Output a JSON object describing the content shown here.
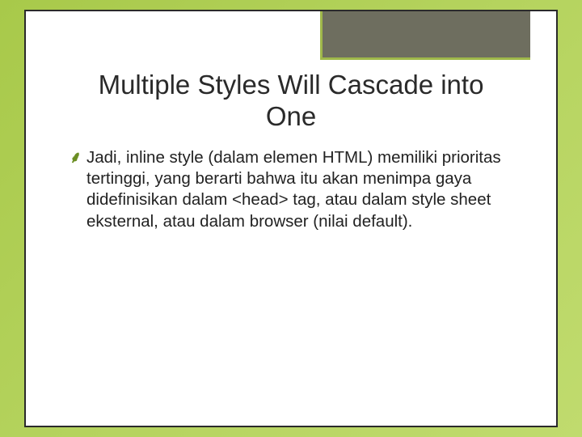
{
  "slide": {
    "title": "Multiple Styles Will Cascade into One",
    "bullet_glyph": "̾",
    "body": "Jadi, inline style (dalam elemen HTML) memiliki prioritas tertinggi, yang berarti bahwa itu akan menimpa gaya didefinisikan dalam <head> tag, atau dalam style sheet eksternal, atau dalam browser (nilai default)."
  }
}
